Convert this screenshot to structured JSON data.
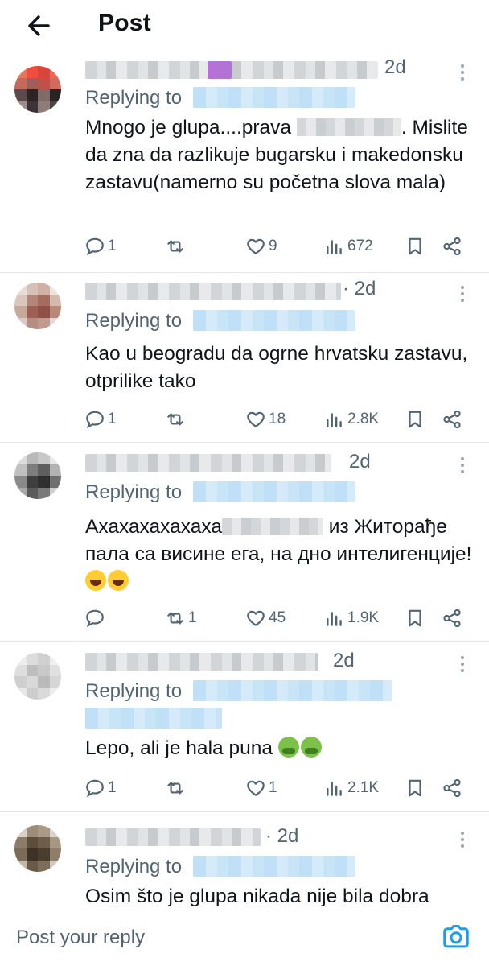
{
  "header": {
    "title": "Post"
  },
  "replies": [
    {
      "time": "2d",
      "replying_label": "Replying to",
      "text_before": "Mnogo je glupa....prava",
      "text_after": ". Mislite da zna da razlikuje bugarsku i makedonsku zastavu(namerno su početna slova mala)",
      "replies": "1",
      "reposts": "",
      "likes": "9",
      "views": "672"
    },
    {
      "time": "· 2d",
      "replying_label": "Replying to",
      "text": "Kao u beogradu da ogrne hrvatsku zastavu, otprilike tako",
      "replies": "1",
      "reposts": "",
      "likes": "18",
      "views": "2.8K"
    },
    {
      "time": "2d",
      "replying_label": "Replying to",
      "text_before": "Ахахахахахаха",
      "text_after": " из Житорађе пала са висине ега, на дно интелигенције!",
      "emoji": [
        "rolling-on-floor-laughing",
        "tears-of-joy"
      ],
      "replies": "",
      "reposts": "1",
      "likes": "45",
      "views": "1.9K"
    },
    {
      "time": "2d",
      "replying_label": "Replying to",
      "text": "Lepo, ali je hala puna",
      "emoji": [
        "nauseated-face",
        "nauseated-face"
      ],
      "replies": "1",
      "reposts": "",
      "likes": "1",
      "views": "2.1K"
    },
    {
      "time": "· 2d",
      "replying_label": "Replying to",
      "text": "Osim što je glupa nikada nije bila dobra"
    }
  ],
  "composer": {
    "placeholder": "Post your reply"
  },
  "colors": {
    "text": "#0f1419",
    "muted": "#536471",
    "accent": "#1d9bf0",
    "divider": "#e3e7ea"
  }
}
